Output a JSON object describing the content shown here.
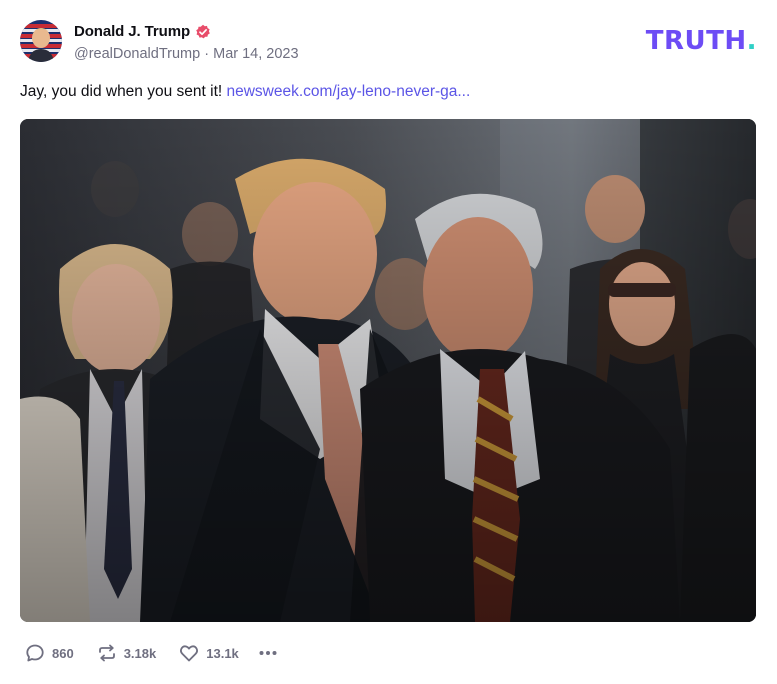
{
  "author": {
    "display_name": "Donald J. Trump",
    "handle": "@realDonaldTrump",
    "separator": "·",
    "date": "Mar 14, 2023",
    "verified_color": "#e84d6a"
  },
  "brand": {
    "wordmark": "TRUTH",
    "dot": ".",
    "primary_color": "#6d4cf5",
    "dot_color": "#2fd0c6"
  },
  "post": {
    "text": "Jay, you did when you sent it! ",
    "link_text": "newsweek.com/jay-leno-never-ga...",
    "link_color": "#5b55e6"
  },
  "media": {
    "icon": "photo-image"
  },
  "actions": {
    "replies": "860",
    "retruths": "3.18k",
    "likes": "13.1k"
  }
}
